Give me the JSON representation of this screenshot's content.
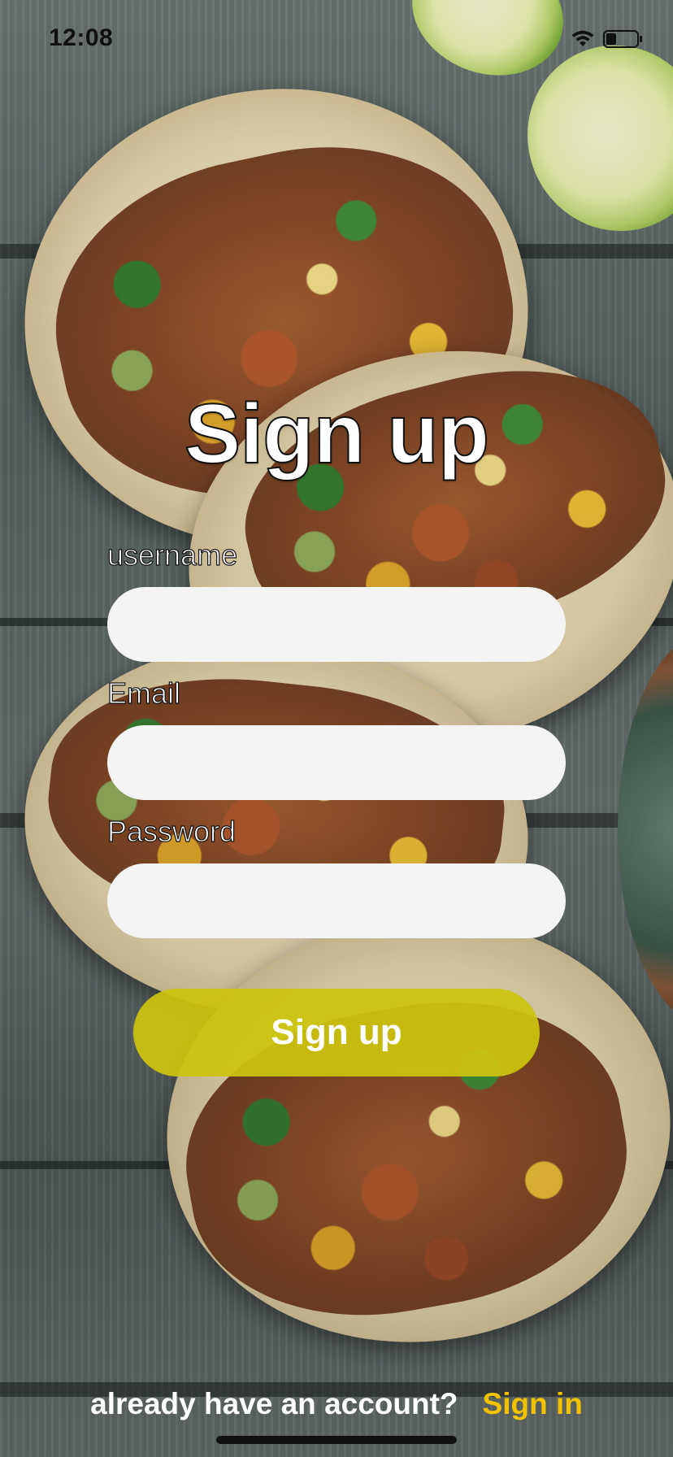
{
  "status_bar": {
    "time": "12:08",
    "icons": [
      "wifi-icon",
      "battery-icon"
    ]
  },
  "form": {
    "title": "Sign up",
    "username": {
      "label": "username",
      "value": ""
    },
    "email": {
      "label": "Email",
      "value": ""
    },
    "password": {
      "label": "Password",
      "value": ""
    },
    "submit_label": "Sign up"
  },
  "footer": {
    "prompt": "already have an account?",
    "link_label": "Sign in"
  },
  "colors": {
    "accent_button": "#CCC40E",
    "link": "#F2C200",
    "field_background": "#F4F4F4",
    "text_light": "#FFFFFF"
  }
}
